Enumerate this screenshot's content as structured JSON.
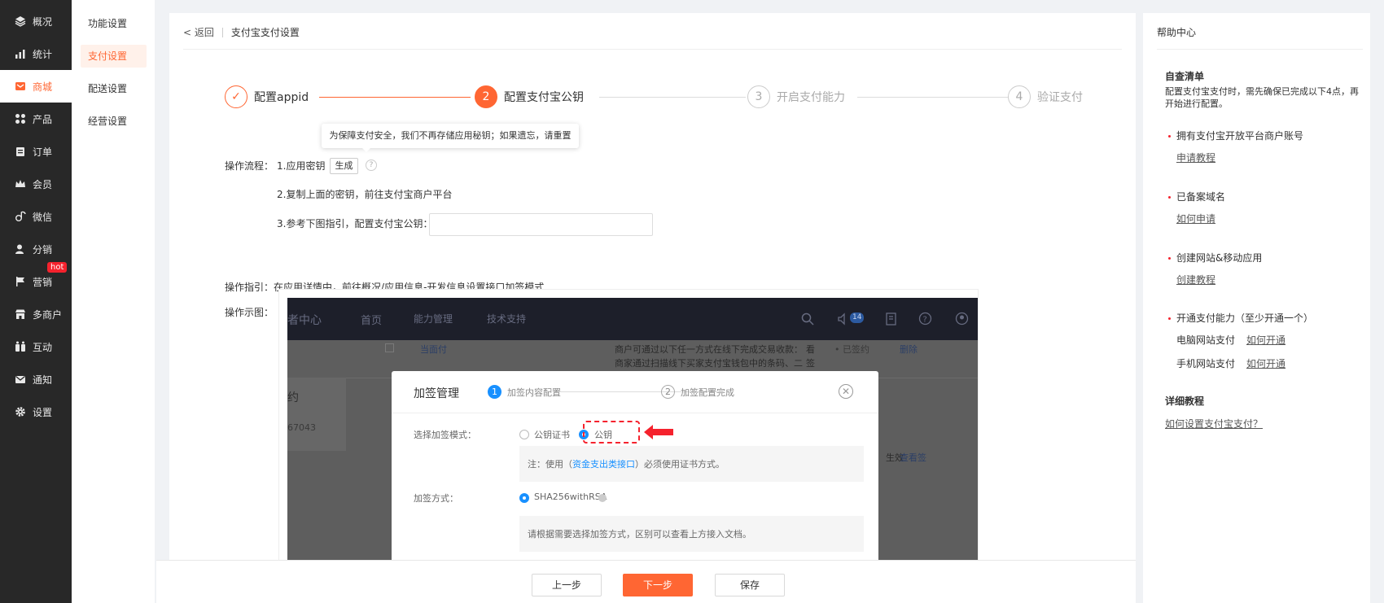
{
  "sidebar": {
    "items": [
      {
        "label": "概况",
        "icon": "layers-icon"
      },
      {
        "label": "统计",
        "icon": "chart-icon"
      },
      {
        "label": "商城",
        "icon": "shop-icon",
        "active": true
      },
      {
        "label": "产品",
        "icon": "grid-icon"
      },
      {
        "label": "订单",
        "icon": "clipboard-icon"
      },
      {
        "label": "会员",
        "icon": "crown-icon"
      },
      {
        "label": "微信",
        "icon": "wechat-icon"
      },
      {
        "label": "分销",
        "icon": "user-icon"
      },
      {
        "label": "营销",
        "icon": "flag-icon"
      },
      {
        "label": "多商户",
        "icon": "store-icon"
      },
      {
        "label": "互动",
        "icon": "interact-icon"
      },
      {
        "label": "通知",
        "icon": "mail-icon"
      },
      {
        "label": "设置",
        "icon": "gear-icon"
      }
    ],
    "hot_badge": "hot"
  },
  "subnav": {
    "items": [
      "功能设置",
      "支付设置",
      "配送设置",
      "经营设置"
    ],
    "active_index": 1
  },
  "breadcrumb": {
    "back": "< 返回",
    "title": "支付宝支付设置"
  },
  "steps": [
    {
      "num": "✓",
      "label": "配置appid",
      "state": "done"
    },
    {
      "num": "2",
      "label": "配置支付宝公钥",
      "state": "current"
    },
    {
      "num": "3",
      "label": "开启支付能力",
      "state": "todo"
    },
    {
      "num": "4",
      "label": "验证支付",
      "state": "todo"
    }
  ],
  "tooltip": "为保障支付安全，我们不再存储应用秘钥；如果遗忘，请重置",
  "flow": {
    "label": "操作流程：",
    "step1": "1.应用密钥",
    "generate_btn": "生成",
    "qmark": "?",
    "step2": "2.复制上面的密钥，前往支付宝商户平台",
    "step3": "3.参考下图指引，配置支付宝公钥："
  },
  "guide": {
    "label": "操作指引：",
    "prefix": "在应用详情中，前往",
    "link": "概况/应用信息-开发信息",
    "suffix": "设置接口加签模式"
  },
  "example": {
    "label": "操作示图：",
    "top": {
      "brand": "者中心",
      "nav1": "首页",
      "nav2": "能力管理",
      "nav3": "技术支持",
      "badge": "14"
    },
    "bg": {
      "t1": "当面付",
      "t2": "商户可通过以下任一方式在线下完成交易收款：",
      "t3": "商家通过扫描线下买家支付宝钱包中的条码、二",
      "t4": "• 已签约",
      "t5": "删除",
      "t6": "约",
      "t7": "67043",
      "t8": "生效",
      "t9": "查看签",
      "t10": "看",
      "t11": "签"
    },
    "dialog": {
      "title": "加签管理",
      "s1": "加签内容配置",
      "s2": "加签配置完成",
      "close": "✕",
      "mode_label": "选择加签模式：",
      "opt_cert": "公钥证书",
      "opt_key": "公钥",
      "note_pre": "注：使用（",
      "note_link": "资金支出类接口",
      "note_post": "）必须使用证书方式。",
      "method_label": "加签方式：",
      "method_value": "SHA256withRSA",
      "note2": "请根据需要选择加签方式，区别可以查看上方接入文档。"
    }
  },
  "footer": {
    "prev": "上一步",
    "next": "下一步",
    "save": "保存"
  },
  "help": {
    "title": "帮助中心",
    "checklist_title": "自查清单",
    "checklist_desc": "配置支付宝支付时，需先确保已完成以下4点，再开始进行配置。",
    "items": [
      {
        "text": "拥有支付宝开放平台商户账号",
        "link": "申请教程"
      },
      {
        "text": "已备案域名",
        "link": "如何申请"
      },
      {
        "text": "创建网站&移动应用",
        "link": "创建教程"
      },
      {
        "text": "开通支付能力（至少开通一个）"
      }
    ],
    "pc_pay": "电脑网站支付",
    "pc_link": "如何开通",
    "mobile_pay": "手机网站支付",
    "mobile_link": "如何开通",
    "tutorial_title": "详细教程",
    "tutorial_link": "如何设置支付宝支付？"
  },
  "colors": {
    "accent": "#ff6633",
    "sidebar_bg": "#282828",
    "blue": "#1890ff",
    "red": "#f5222d"
  }
}
